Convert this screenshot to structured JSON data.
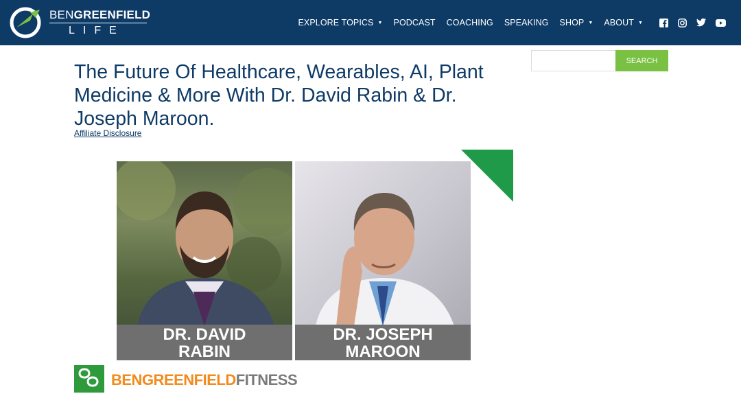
{
  "header": {
    "logo": {
      "word1": "BEN",
      "word2": "GREENFIELD",
      "word3": "LIFE"
    },
    "nav": [
      {
        "label": "EXPLORE TOPICS",
        "dropdown": true
      },
      {
        "label": "PODCAST",
        "dropdown": false
      },
      {
        "label": "COACHING",
        "dropdown": false
      },
      {
        "label": "SPEAKING",
        "dropdown": false
      },
      {
        "label": "SHOP",
        "dropdown": true
      },
      {
        "label": "ABOUT",
        "dropdown": true
      }
    ],
    "caret": "▼",
    "social_icons": [
      "facebook-icon",
      "instagram-icon",
      "twitter-icon",
      "youtube-icon"
    ]
  },
  "search": {
    "placeholder": "",
    "button_label": "SEARCH"
  },
  "article": {
    "title": "The Future Of Healthcare, Wearables, AI, Plant Medicine & More With Dr. David Rabin & Dr. Joseph Maroon.",
    "disclosure": "Affiliate Disclosure"
  },
  "hero": {
    "left_name_line1": "DR. DAVID",
    "left_name_line2": "RABIN",
    "right_name_line1": "DR. JOSEPH",
    "right_name_line2": "MAROON"
  },
  "footer_logo": {
    "part1": "BENGREENFIELD",
    "part2": "FITNESS"
  },
  "colors": {
    "navy": "#0e3a66",
    "green": "#7ac143",
    "dark_green": "#1f9a48",
    "orange": "#f28a1c",
    "plate_grey": "#6f6f6f"
  }
}
